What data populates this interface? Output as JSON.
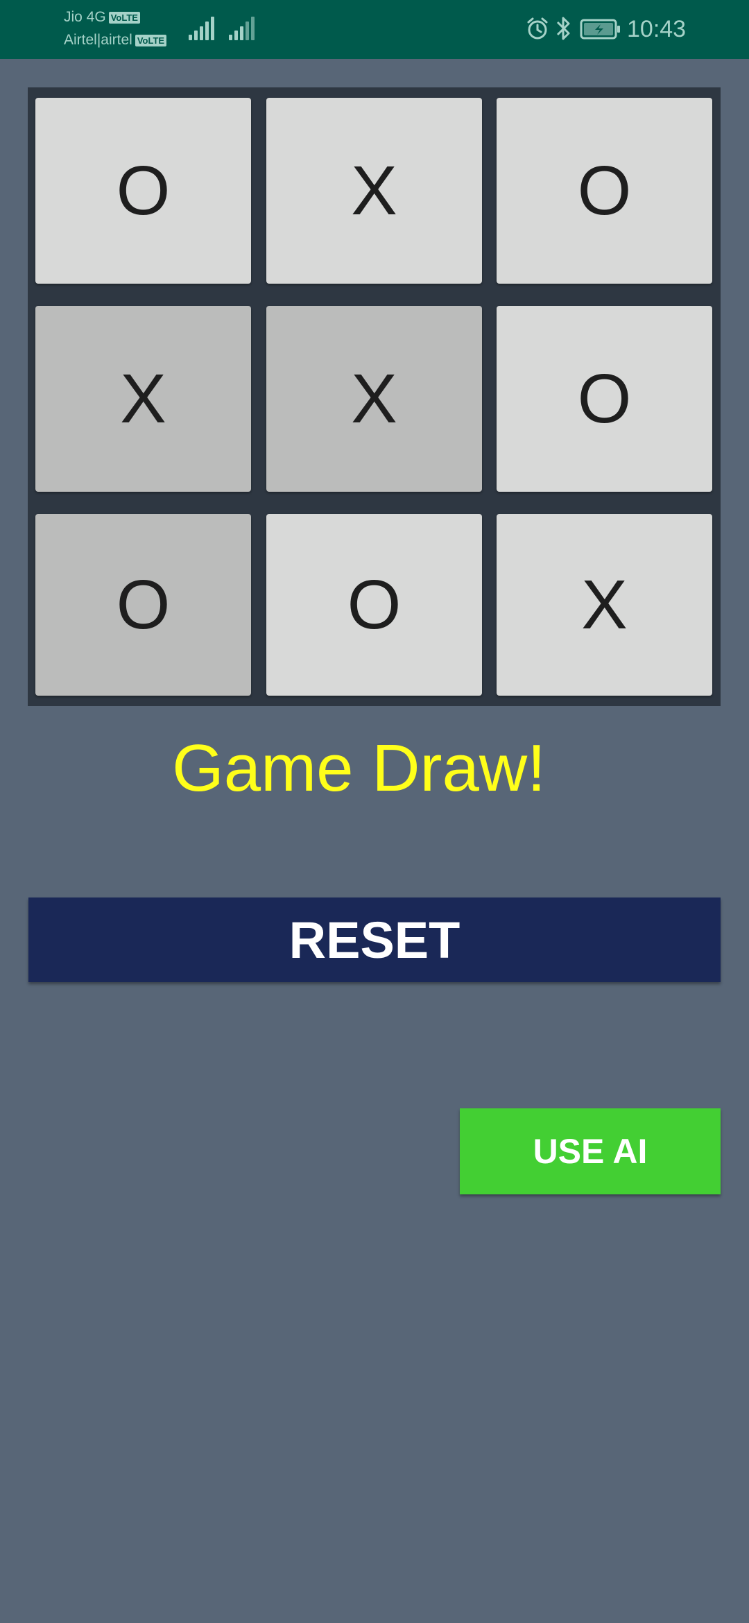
{
  "status_bar": {
    "carrier_1": "Jio 4G",
    "carrier_2": "Airtel|airtel",
    "volte_badge": "VoLTE",
    "time": "10:43",
    "icons": [
      "signal-icon",
      "signal-icon",
      "alarm-icon",
      "bluetooth-icon",
      "battery-charging-icon"
    ]
  },
  "board": {
    "cells": [
      "O",
      "X",
      "O",
      "X",
      "X",
      "O",
      "O",
      "O",
      "X"
    ],
    "highlighted_cells": [
      3,
      4,
      6
    ]
  },
  "result_text": "Game Draw!",
  "reset_label": "RESET",
  "ai_label": "USE AI",
  "colors": {
    "status_bar": "#005a4c",
    "background": "#586677",
    "board": "#2e3742",
    "cell": "#d8d9d8",
    "cell_highlight": "#bbbcbb",
    "result_text": "#ffff1a",
    "reset_button": "#1a2857",
    "ai_button": "#43cf33"
  }
}
